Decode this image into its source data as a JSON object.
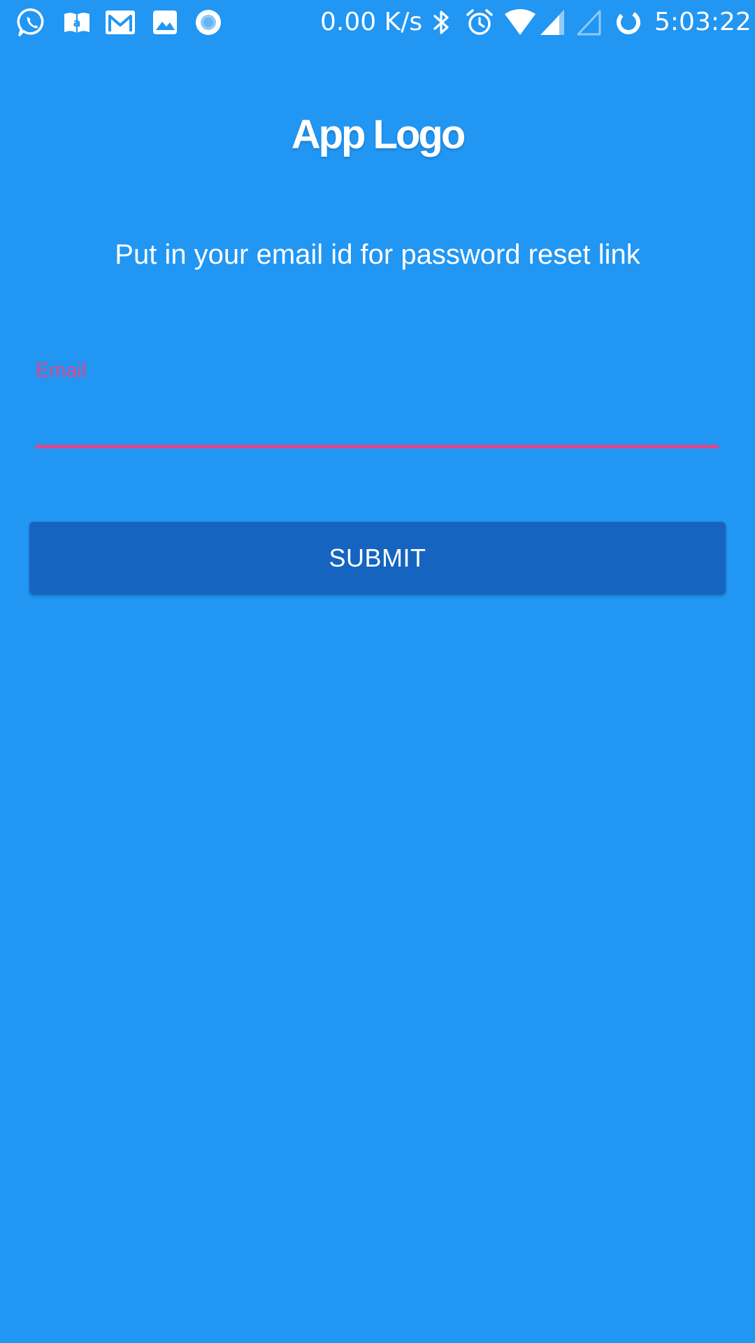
{
  "status_bar": {
    "notification_icons": [
      "whatsapp-icon",
      "amazon-kindle-icon",
      "gmail-icon",
      "gallery-icon",
      "record-icon"
    ],
    "network_speed": "0.00 K/s",
    "system_icons": [
      "bluetooth-icon",
      "alarm-icon",
      "wifi-icon",
      "signal-icon",
      "signal-empty-icon",
      "sync-icon"
    ],
    "time": "5:03:22"
  },
  "page": {
    "logo_text": "App Logo",
    "instructions": "Put in your email id for password reset link"
  },
  "form": {
    "email_label": "Email",
    "email_value": "",
    "submit_label": "SUBMIT"
  },
  "colors": {
    "background": "#2196F3",
    "button": "#1565C0",
    "accent": "#E2458B",
    "text": "#FFFFFF"
  }
}
